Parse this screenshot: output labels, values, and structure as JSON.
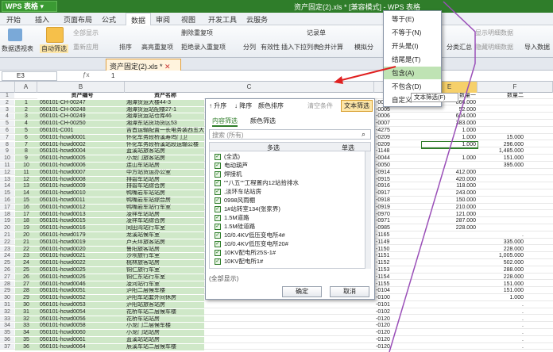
{
  "app": {
    "name": "WPS 表格",
    "doc_title": "资产固定(2).xls * [兼容模式] - WPS 表格"
  },
  "menu": [
    "开始",
    "插入",
    "页面布局",
    "公式",
    "数据",
    "审阅",
    "视图",
    "开发工具",
    "云服务"
  ],
  "ribbon": {
    "pivot": "数据透视表",
    "autofilter": "自动筛选",
    "showall": "全部显示",
    "reapply": "重新应用",
    "sort": "排序",
    "advfilter": "高亮重复项",
    "removedup": "删除重复项",
    "rejectdup": "拒绝录入重复项",
    "split": "分列",
    "validity": "有效性",
    "insertdd": "插入下拉列表",
    "merge": "合并计算",
    "simulate": "模拟分",
    "record": "记录单",
    "group": "分类汇总",
    "showdetail": "显示明细数据",
    "hidedetail": "隐藏明细数据",
    "import": "导入数据"
  },
  "file_tab": "资产固定(2).xls *",
  "namebox": "E3",
  "formula": "1",
  "columns": [
    "A",
    "B",
    "C",
    "D",
    "E",
    "F"
  ],
  "header_row": {
    "A": "",
    "B": "资产编号",
    "C": "资产名称",
    "E": "数量一",
    "F": "数量二"
  },
  "rows": [
    {
      "n": "1",
      "a": "",
      "b": "资产编号",
      "c": "资产名称",
      "d": "",
      "e": "数量一",
      "f": "数量二"
    },
    {
      "n": "2",
      "a": "1",
      "b": "050101-CH-00247",
      "c": "湘潭货运大楼44-3",
      "d": "-0006",
      "e": "866.000",
      "f": ""
    },
    {
      "n": "3",
      "a": "2",
      "b": "050101-CH-00248",
      "c": "湘潭货运站配楼27-1",
      "d": "-0005",
      "e": "52.000",
      "f": ""
    },
    {
      "n": "4",
      "a": "3",
      "b": "050101-CH-00249",
      "c": "湘潭货运站仓库46",
      "d": "-0006",
      "e": "604.000",
      "f": ""
    },
    {
      "n": "5",
      "a": "4",
      "b": "050101-CH-00250",
      "c": "湘潭东站货场货区53",
      "d": "-0007",
      "e": "383.000",
      "f": ""
    },
    {
      "n": "6",
      "a": "5",
      "b": "050101-C001",
      "c": "吉首运输配置一长电务装西五大楼",
      "d": "-4275",
      "e": "1.000",
      "f": ""
    },
    {
      "n": "7",
      "a": "6",
      "b": "050101-hcwd0001",
      "c": "怀化车务段桥溪寿坞门卫",
      "d": "-0209",
      "e": "1.000",
      "f": "15.000"
    },
    {
      "n": "8",
      "a": "7",
      "b": "050101-hcwd0002",
      "c": "怀化车务段桥溪站段运输公楼",
      "d": "-0209",
      "e": "1.000",
      "f": "296.000"
    },
    {
      "n": "9",
      "a": "8",
      "b": "050101-hcwd0004",
      "c": "蓝溪站旅客站房",
      "d": "-1148",
      "e": "",
      "f": "1,485.000"
    },
    {
      "n": "10",
      "a": "9",
      "b": "050101-hcwd0005",
      "c": "小龙门旅客站房",
      "d": "-0044",
      "e": "1.000",
      "f": "151.000"
    },
    {
      "n": "11",
      "a": "10",
      "b": "050101-hcwd0006",
      "c": "连山车站站房",
      "d": "-0050",
      "e": "",
      "f": "395.000"
    },
    {
      "n": "12",
      "a": "11",
      "b": "050101-hcwd0007",
      "c": "中方站货运办公室",
      "d": "-0914",
      "e": "412.000",
      "f": ""
    },
    {
      "n": "13",
      "a": "12",
      "b": "050101-hcwd0008",
      "c": "排碧车站站房",
      "d": "-0915",
      "e": "420.000",
      "f": ""
    },
    {
      "n": "14",
      "a": "13",
      "b": "050101-hcwd0009",
      "c": "排碧车站综合房",
      "d": "-0916",
      "e": "118.000",
      "f": ""
    },
    {
      "n": "15",
      "a": "14",
      "b": "050101-hcwd0010",
      "c": "鸭嘴岩车站站房",
      "d": "-0917",
      "e": "243.000",
      "f": ""
    },
    {
      "n": "16",
      "a": "15",
      "b": "050101-hcwd0011",
      "c": "鸭嘴岩车站综合房",
      "d": "-0918",
      "e": "150.000",
      "f": ""
    },
    {
      "n": "17",
      "a": "16",
      "b": "050101-hcwd0012",
      "c": "鸭嘴岩车站行车室",
      "d": "-0919",
      "e": "210.000",
      "f": ""
    },
    {
      "n": "18",
      "a": "17",
      "b": "050101-hcwd0013",
      "c": "凌祥车站站房",
      "d": "-0970",
      "e": "121.000",
      "f": ""
    },
    {
      "n": "19",
      "a": "18",
      "b": "050101-hcwd0015",
      "c": "凌祥车站综合房",
      "d": "-0971",
      "e": "287.000",
      "f": ""
    },
    {
      "n": "20",
      "a": "19",
      "b": "050101-hcwd0016",
      "c": "同田湾站行车室",
      "d": "-0985",
      "e": "228.000",
      "f": ""
    },
    {
      "n": "21",
      "a": "20",
      "b": "050101-hcwd0179",
      "c": "龙溪站候车室",
      "d": "-1165",
      "e": "",
      "f": "."
    },
    {
      "n": "22",
      "a": "21",
      "b": "050101-hcwd0019",
      "c": "芦天坪旅客站房",
      "d": "-1149",
      "e": "",
      "f": "335.000"
    },
    {
      "n": "23",
      "a": "22",
      "b": "050101-hcwd0020",
      "c": "鲁阳旅客站房",
      "d": "-1150",
      "e": "",
      "f": "228.000"
    },
    {
      "n": "24",
      "a": "23",
      "b": "050101-hcwd0021",
      "c": "沙坝旅行车室",
      "d": "-1151",
      "e": "",
      "f": "1,005.000"
    },
    {
      "n": "25",
      "a": "24",
      "b": "050101-hcwd0022",
      "c": "桃林旅客站房",
      "d": "-1152",
      "e": "",
      "f": "502.000"
    },
    {
      "n": "26",
      "a": "25",
      "b": "050101-hcwd0025",
      "c": "铜仁旅行车室",
      "d": "-1153",
      "e": "",
      "f": "288.000"
    },
    {
      "n": "27",
      "a": "26",
      "b": "050101-hcwd0026",
      "c": "铜仁东站行车室",
      "d": "-1154",
      "e": "",
      "f": "228.000"
    },
    {
      "n": "28",
      "a": "27",
      "b": "050101-hcwd0046",
      "c": "凌河站行车室",
      "d": "-1155",
      "e": "",
      "f": "151.000"
    },
    {
      "n": "29",
      "a": "28",
      "b": "050101-hcwd0051",
      "c": "泸阳二层候车楼",
      "d": "-0104",
      "e": "",
      "f": "151.000"
    },
    {
      "n": "30",
      "a": "29",
      "b": "050101-hcwd0052",
      "c": "泸阳车站套外间休房",
      "d": "-0100",
      "e": "",
      "f": "1.000"
    },
    {
      "n": "31",
      "a": "30",
      "b": "050101-hcwd0053",
      "c": "泸阳站旅客站房",
      "d": "-0101",
      "e": "",
      "f": "."
    },
    {
      "n": "32",
      "a": "31",
      "b": "050101-hcwd0054",
      "c": "花桥车站二层候车楼",
      "d": "-0102",
      "e": "",
      "f": "."
    },
    {
      "n": "33",
      "a": "32",
      "b": "050101-hcwd0056",
      "c": "花桥车站站房",
      "d": "-0120",
      "e": "",
      "f": "."
    },
    {
      "n": "34",
      "a": "33",
      "b": "050101-hcwd0058",
      "c": "小龙门二层候车楼",
      "d": "-0120",
      "e": "",
      "f": "."
    },
    {
      "n": "35",
      "a": "34",
      "b": "050101-hcwd0060",
      "c": "小龙门站站房",
      "d": "-0120",
      "e": "",
      "f": "."
    },
    {
      "n": "36",
      "a": "35",
      "b": "050101-hcwd0061",
      "c": "蓝溪站站站房",
      "d": "-0120",
      "e": "",
      "f": "."
    },
    {
      "n": "37",
      "a": "36",
      "b": "050101-hcwd0064",
      "c": "辰溪车站二层候车楼",
      "d": "-0120",
      "e": "",
      "f": "."
    }
  ],
  "filter_panel": {
    "sort_asc": "升序",
    "sort_desc": "降序",
    "color_sort": "颜色排序",
    "clear": "清空条件",
    "text_filter": "文本筛选",
    "tab_content": "内容筛选",
    "tab_color": "颜色筛选",
    "search_placeholder": "搜索 (所有)",
    "col_multi": "多选",
    "col_single": "单选",
    "items": [
      "(全选)",
      "电动葫芦",
      "焊接机",
      "\"\"八五\"\"工程置内12站拾排水",
      ",淡环车站站房",
      "0998风雨棚",
      "1#站转室134(张家界)",
      "1.5M道路",
      "1.5M硅道路",
      "10/0.4KV低压变电所4#",
      "10/0.4KV低压变电所20#",
      "10KV配电所25S-1#",
      "10KV配电所1#"
    ],
    "show_all": "(全部显示)",
    "ok": "确定",
    "cancel": "取消"
  },
  "dropdown_menu": {
    "items": [
      "等于(E)",
      "不等于(N)",
      "开头是(I)",
      "结尾是(T)",
      "包含(A)",
      "不包含(D)",
      "自定义"
    ],
    "highlighted": "包含(A)",
    "tooltip": "文本筛选(F)"
  }
}
